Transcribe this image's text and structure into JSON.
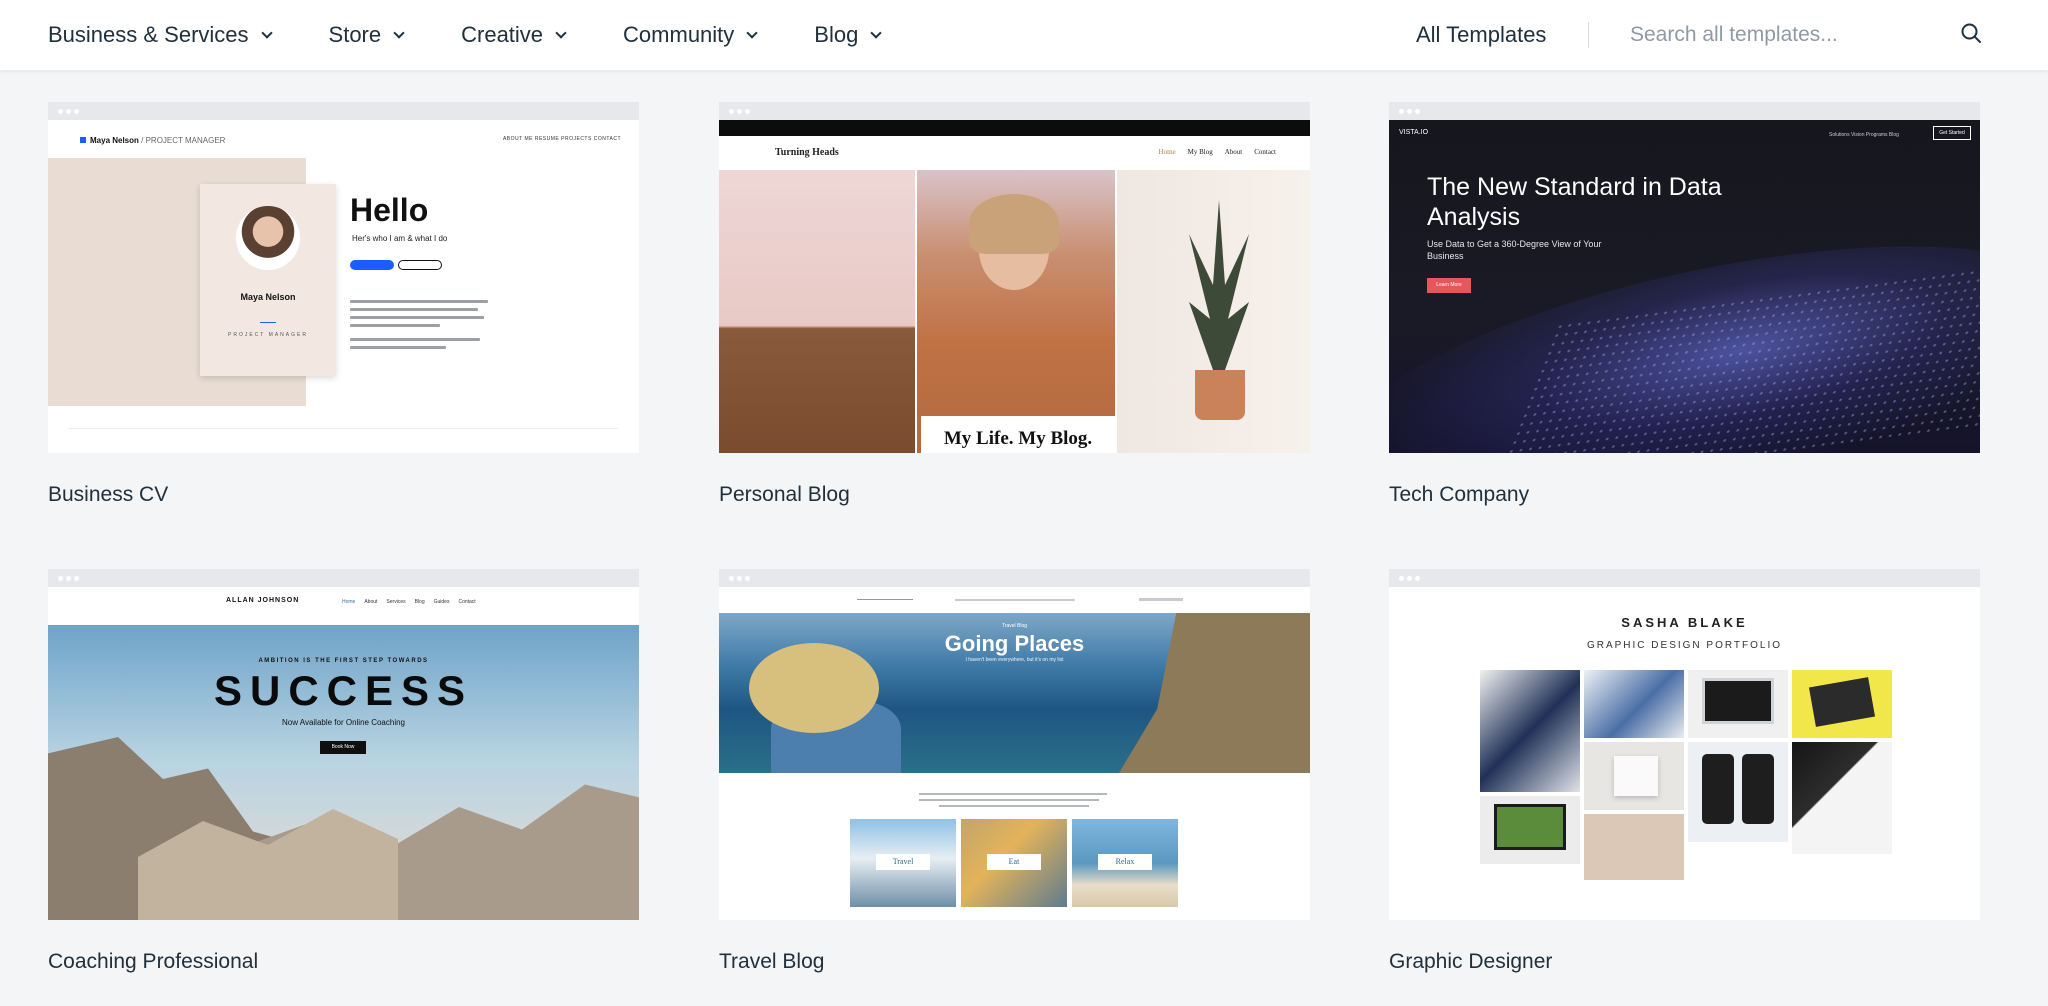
{
  "nav": {
    "items": [
      {
        "label": "Business & Services"
      },
      {
        "label": "Store"
      },
      {
        "label": "Creative"
      },
      {
        "label": "Community"
      },
      {
        "label": "Blog"
      }
    ],
    "all_templates": "All Templates",
    "search_placeholder": "Search all templates..."
  },
  "templates": [
    {
      "title": "Business CV"
    },
    {
      "title": "Personal Blog"
    },
    {
      "title": "Tech Company"
    },
    {
      "title": "Coaching Professional"
    },
    {
      "title": "Travel Blog"
    },
    {
      "title": "Graphic Designer"
    }
  ],
  "previews": {
    "cv": {
      "logo": "Maya Nelson",
      "logo_role": "/ PROJECT MANAGER",
      "nav_links": "ABOUT ME   RESUME   PROJECTS   CONTACT",
      "hello": "Hello",
      "sub": "Her's who I am & what I do",
      "card_name": "Maya Nelson",
      "card_role": "PROJECT MANAGER"
    },
    "blog": {
      "title": "Turning Heads",
      "links": [
        "Home",
        "My Blog",
        "About",
        "Contact"
      ],
      "caption": "My Life. My Blog."
    },
    "tech": {
      "logo": "VISTA.IO",
      "links": "Solutions   Vision   Programs   Blog",
      "cta": "Get Started",
      "headline": "The New Standard in Data Analysis",
      "sub": "Use Data to Get a 360-Degree View of Your Business",
      "button": "Learn More"
    },
    "coach": {
      "name": "ALLAN JOHNSON",
      "links": [
        "Home",
        "About",
        "Services",
        "Blog",
        "Guides",
        "Contact"
      ],
      "kicker": "AMBITION IS THE FIRST STEP TOWARDS",
      "headline": "SUCCESS",
      "sub": "Now Available for Online Coaching",
      "button": "Book Now"
    },
    "travel": {
      "tag": "Travel Blog",
      "headline": "Going Places",
      "sub": "I haven't been everywhere, but it's on my list",
      "labels": [
        "Travel",
        "Eat",
        "Relax"
      ]
    },
    "designer": {
      "name": "SASHA BLAKE",
      "sub": "GRAPHIC DESIGN PORTFOLIO"
    }
  },
  "colors": {
    "page_bg": "#f4f5f7",
    "text": "#20303c",
    "placeholder": "#8f9aa4"
  },
  "icons": {
    "nav_dropdown": "chevron-down-icon",
    "search": "search-icon"
  }
}
